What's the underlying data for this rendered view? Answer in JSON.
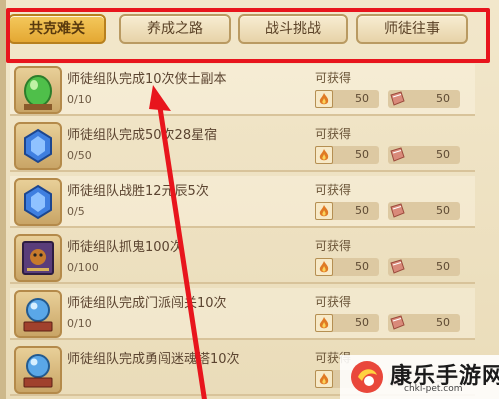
{
  "tabs": [
    {
      "label": "共克难关",
      "active": true
    },
    {
      "label": "养成之路",
      "active": false
    },
    {
      "label": "战斗挑战",
      "active": false
    },
    {
      "label": "师徒往事",
      "active": false
    }
  ],
  "reward_label": "可获得",
  "tasks": [
    {
      "title": "师徒组队完成10次侠士副本",
      "progress": "0/10",
      "reward_a": "50",
      "reward_b": "50",
      "icon": "green-gem-icon"
    },
    {
      "title": "师徒组队完成50次28星宿",
      "progress": "0/50",
      "reward_a": "50",
      "reward_b": "50",
      "icon": "blue-crystal-icon"
    },
    {
      "title": "师徒组队战胜12元辰5次",
      "progress": "0/5",
      "reward_a": "50",
      "reward_b": "50",
      "icon": "blue-crystal-icon"
    },
    {
      "title": "师徒组队抓鬼100次",
      "progress": "0/100",
      "reward_a": "50",
      "reward_b": "50",
      "icon": "ghost-book-icon"
    },
    {
      "title": "师徒组队完成门派闯关10次",
      "progress": "0/10",
      "reward_a": "50",
      "reward_b": "50",
      "icon": "crystal-orb-icon"
    },
    {
      "title": "师徒组队完成勇闯迷魂塔10次",
      "progress": "",
      "reward_a": "50",
      "reward_b": "50",
      "icon": "crystal-orb-icon"
    }
  ],
  "reward_icons": [
    "flame-icon",
    "book-icon"
  ],
  "colors": {
    "highlight": "#e8151d",
    "active_tab": "#f4c85c"
  },
  "watermark": {
    "name": "康乐手游网",
    "url": "chkl-pet.com"
  }
}
